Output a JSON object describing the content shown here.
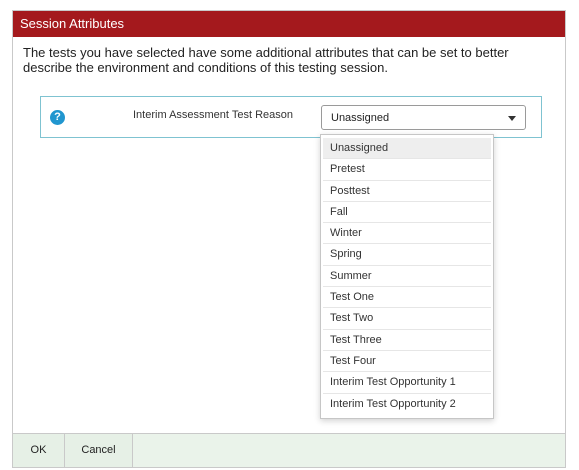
{
  "dialog": {
    "title": "Session Attributes",
    "description": "The tests you have selected have some additional attributes that can be set to better describe the environment and conditions of this testing session."
  },
  "attribute": {
    "help_icon": "question-circle-icon",
    "help_glyph": "?",
    "label": "Interim Assessment Test Reason",
    "selected_value": "Unassigned",
    "options": [
      "Unassigned",
      "Pretest",
      "Posttest",
      "Fall",
      "Winter",
      "Spring",
      "Summer",
      "Test One",
      "Test Two",
      "Test Three",
      "Test Four",
      "Interim Test Opportunity 1",
      "Interim Test Opportunity 2"
    ]
  },
  "footer": {
    "ok_label": "OK",
    "cancel_label": "Cancel"
  },
  "colors": {
    "title_bar": "#a4191d",
    "help_icon": "#2196cf",
    "row_border": "#7fc3d1",
    "footer_bg": "#eaf3ea"
  }
}
